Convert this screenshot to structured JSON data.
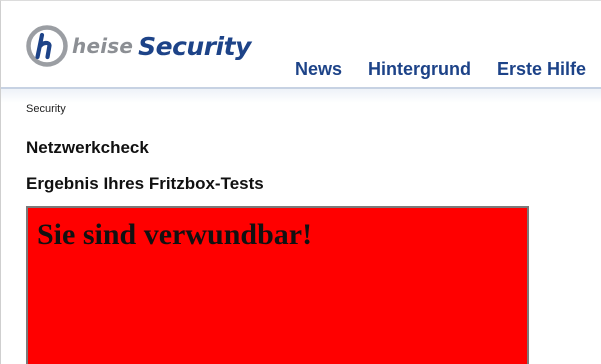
{
  "logo": {
    "heise": "heise",
    "security": "Security",
    "brand_blue": "#1d4388",
    "mark_gray": "#8c8f94"
  },
  "nav": {
    "items": [
      {
        "label": "News"
      },
      {
        "label": "Hintergrund"
      },
      {
        "label": "Erste Hilfe"
      }
    ]
  },
  "breadcrumb": "Security",
  "page": {
    "title": "Netzwerkcheck",
    "subtitle": "Ergebnis Ihres Fritzbox-Tests"
  },
  "result": {
    "message": "Sie sind verwundbar!",
    "background": "#ff0000"
  }
}
